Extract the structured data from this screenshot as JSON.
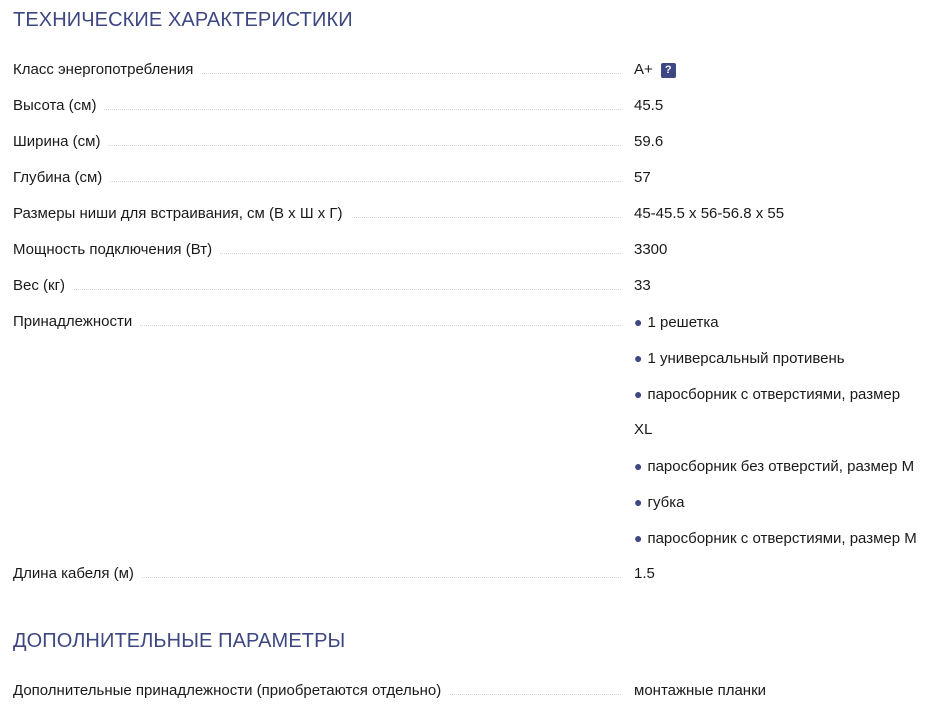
{
  "sections": [
    {
      "title": "ТЕХНИЧЕСКИЕ ХАРАКТЕРИСТИКИ",
      "rows": [
        {
          "label": "Класс энергопотребления",
          "value": "A+",
          "help_icon": "question-icon"
        },
        {
          "label": "Высота (см)",
          "value": "45.5"
        },
        {
          "label": "Ширина (см)",
          "value": "59.6"
        },
        {
          "label": "Глубина (см)",
          "value": "57"
        },
        {
          "label": "Размеры ниши для встраивания, см (В х Ш х Г)",
          "value": "45-45.5 x 56-56.8 x 55"
        },
        {
          "label": "Мощность подключения (Вт)",
          "value": "3300"
        },
        {
          "label": "Вес (кг)",
          "value": "33"
        },
        {
          "label": "Принадлежности",
          "lines": [
            {
              "bullet": "●",
              "text": "1 решетка"
            },
            {
              "bullet": "●",
              "text": "1 универсальный противень"
            },
            {
              "bullet": "●",
              "text": "паросборник с отверстиями, размер"
            },
            {
              "bullet": "",
              "text": "XL"
            },
            {
              "bullet": "●",
              "text": "паросборник без отверстий, размер M"
            },
            {
              "bullet": "●",
              "text": "губка"
            },
            {
              "bullet": "●",
              "text": "паросборник с отверстиями, размер M"
            }
          ]
        },
        {
          "label": "Длина кабеля (м)",
          "value": "1.5"
        }
      ]
    },
    {
      "title": "ДОПОЛНИТЕЛЬНЫЕ ПАРАМЕТРЫ",
      "rows": [
        {
          "label": "Дополнительные принадлежности (приобретаются отдельно)",
          "value": "монтажные планки"
        }
      ]
    }
  ],
  "colors": {
    "accent": "#3d4781",
    "text": "#1a1a1a",
    "dots": "#d6d6d6"
  }
}
